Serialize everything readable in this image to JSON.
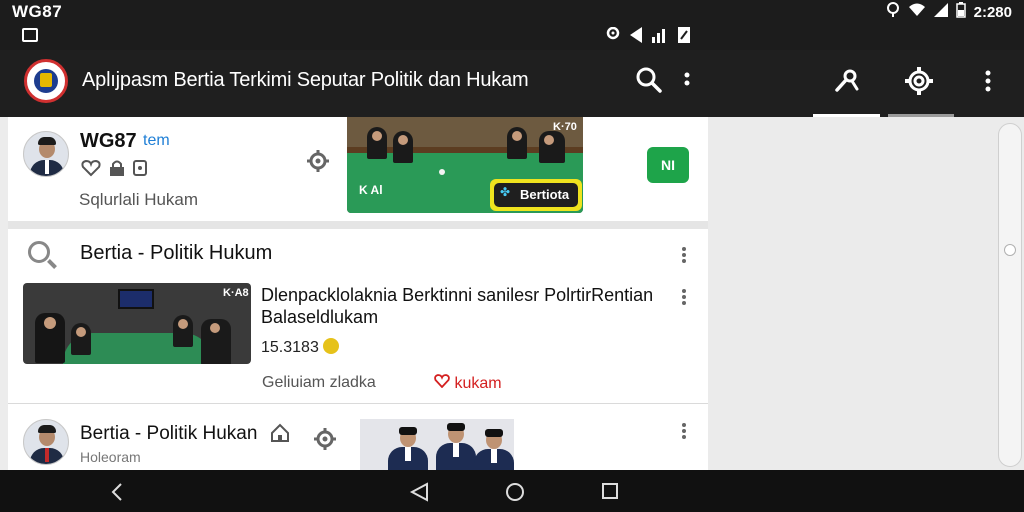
{
  "status_bar": {
    "left_label": "WG87",
    "time": "2:280",
    "icons": [
      "location-icon",
      "wifi-icon",
      "signal-icon",
      "battery-icon"
    ]
  },
  "sub_status": {
    "icons": [
      "camera-icon",
      "location-pin-icon",
      "nav-arrow-icon",
      "signal-bars-icon",
      "nfc-icon"
    ]
  },
  "app_bar": {
    "title": "Aplıjpasm Bertia Terkimi Seputar Politik dan Hukam",
    "icons": [
      "search-icon",
      "more-vert-icon",
      "pen-icon",
      "settings-icon",
      "overflow-icon"
    ]
  },
  "card1": {
    "name": "WG87",
    "tag": "tem",
    "subtitle": "Sqlurlali Hukam",
    "thumb_corner": "K·70",
    "thumb_small": "K Al",
    "badge_label": "Bertiota",
    "action_label": "NI"
  },
  "section2": {
    "header": "Bertia - Politik Hukum",
    "headline_line1": "Dlenpacklolaknia Berktinni  sanilesr  PolrtirRentian",
    "headline_line2": "Balaseldlukam",
    "time": "15.3183",
    "source": "Geliuiam zladka",
    "category": "kukam",
    "thumb_corner": "K·A8"
  },
  "section3": {
    "title": "Bertia - Politik Hukan",
    "subtitle": "Holeoram"
  },
  "colors": {
    "app_bar": "#1f1f1f",
    "accent_green": "#1ea44a",
    "accent_yellow": "#efe31e",
    "accent_red": "#d42020",
    "accent_blue": "#1f7fd6"
  }
}
